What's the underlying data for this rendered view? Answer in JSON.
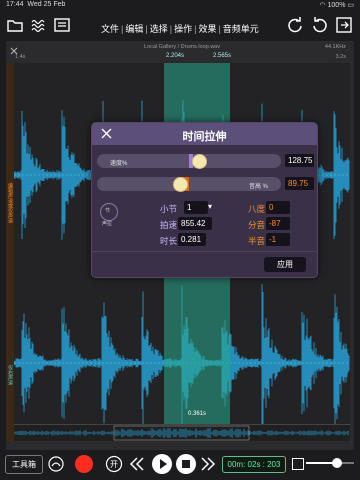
{
  "status_bar": {
    "time": "17:44",
    "date": "Wed 25 Feb",
    "battery": "100%"
  },
  "menu": {
    "items": [
      "文件",
      "编辑",
      "选择",
      "操作",
      "效果",
      "音频单元"
    ],
    "separator": "|"
  },
  "editor": {
    "file_title": "Local Gallery / Drums.loop.wav",
    "sample_rate": "44.1KHz",
    "ruler_left": "1.4s",
    "ruler_right": "3.2s",
    "sel_start": "2.204s",
    "sel_end": "2.565s",
    "sel_length": "0.361s",
    "track_label_top": "编辑声道或仅声道",
    "track_label_bottom": "仅右声道",
    "colors": {
      "waveform": "#27a7e0",
      "selection": "#28aa8c"
    }
  },
  "dialog": {
    "title": "时间拉伸",
    "speed_label": "速度%",
    "speed_value": "128.75",
    "speed_level": 0.52,
    "pitch_label": "音高 %",
    "pitch_value": "89.75",
    "pitch_level": 0.45,
    "dial_label_top": "节",
    "dial_label_bottom": "声拉",
    "bar_label": "小节",
    "bar_value": "1",
    "bpm_label": "拍速",
    "bpm_value": "855.42",
    "duration_label": "时长",
    "duration_value": "0.281",
    "octave_label": "八度",
    "octave_value": "0",
    "cents_label": "分音",
    "cents_value": "-87",
    "semitone_label": "半音",
    "semitone_value": "-1",
    "apply_label": "应用"
  },
  "bottom": {
    "toolbox_label": "工具箱",
    "time": "00m: 02s : 203",
    "volume_level": 0.65
  }
}
